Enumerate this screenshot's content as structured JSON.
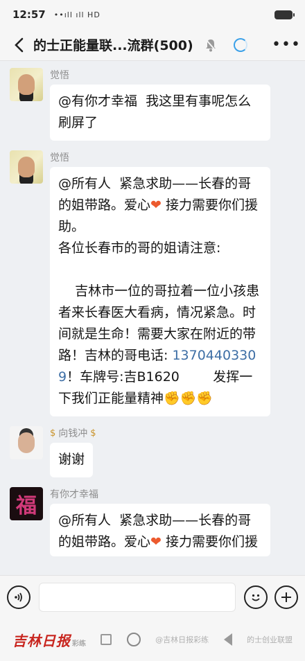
{
  "status_bar": {
    "time": "12:57",
    "signal": "••ıll ıll HD"
  },
  "header": {
    "title": "的士正能量联...流群(500)"
  },
  "messages": [
    {
      "sender": "觉悟",
      "text": "@有你才幸福  我这里有事呢怎么刷屏了"
    },
    {
      "sender": "觉悟",
      "text_a": "@所有人  紧急求助——长春的哥的姐带路。爱心",
      "heart": "❤",
      "text_b": " 接力需要你们援助。\n各位长春市的哥的姐请注意:\n\n    吉林市一位的哥拉着一位小孩患者来长春医大看病，情况紧急。时间就是生命！需要大家在附近的带路！吉林的哥电话: ",
      "phone": "13704403309",
      "text_c": "！车牌号:吉B1620        发挥一下我们正能量精神",
      "fists": "✊✊✊"
    },
    {
      "sender": "向钱冲",
      "badge": "$",
      "text": "谢谢"
    },
    {
      "sender": "有你才幸福",
      "avatar_char": "福",
      "text_a": "@所有人  紧急求助——长春的哥的姐带路。爱心",
      "heart": "❤",
      "text_b": " 接力需要你们援助。"
    }
  ],
  "nav": {
    "brand": "吉林日报",
    "brand_sub": "彩练",
    "watermark_left": "@吉林日报彩练",
    "watermark_right": "的士创业联盟"
  }
}
